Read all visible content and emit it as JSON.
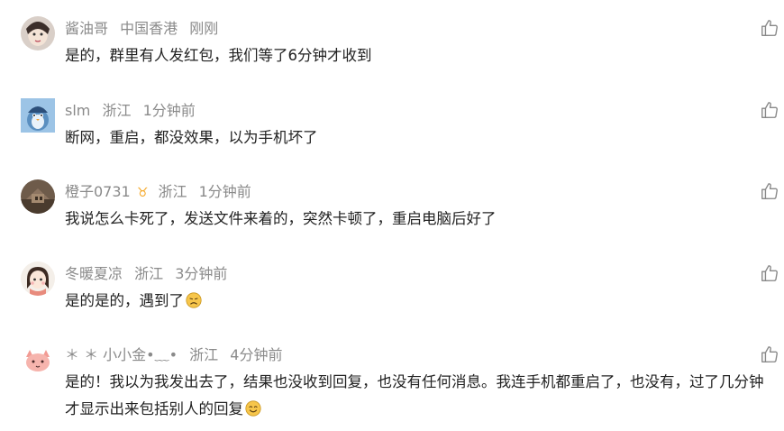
{
  "comments": [
    {
      "user": "酱油哥",
      "location": "中国香港",
      "time": "刚刚",
      "text": "是的，群里有人发红包，我们等了6分钟才收到",
      "emoji": ""
    },
    {
      "user": "slm",
      "location": "浙江",
      "time": "1分钟前",
      "text": "断网，重启，都没效果，以为手机坏了",
      "emoji": ""
    },
    {
      "user": "橙子0731",
      "badge": "♉",
      "location": "浙江",
      "time": "1分钟前",
      "text": "我说怎么卡死了，发送文件来着的，突然卡顿了，重启电脑后好了",
      "emoji": ""
    },
    {
      "user": "冬暖夏凉",
      "location": "浙江",
      "time": "3分钟前",
      "text": "是的是的，遇到了",
      "emoji": "sad-emoji"
    },
    {
      "user": "＊ ＊ 小小金•﹏•",
      "location": "浙江",
      "time": "4分钟前",
      "text": "是的！我以为我发出去了，结果也没收到回复，也没有任何消息。我连手机都重启了，也没有，过了几分钟才显示出来包括别人的回复",
      "emoji": "smile-emoji"
    }
  ],
  "icons": {
    "like": "thumbs-up-icon"
  },
  "colors": {
    "meta": "#8a8a8a",
    "text": "#222222",
    "badge": "#f5a623"
  }
}
